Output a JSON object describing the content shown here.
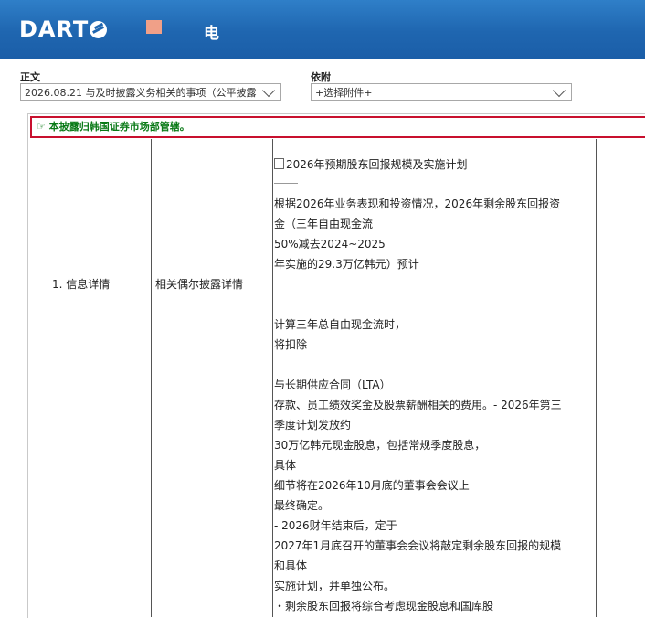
{
  "header": {
    "logo_text": "DART",
    "title": "电"
  },
  "toolbar": {
    "body_label": "正文",
    "body_select_value": "2026.08.21 与及时披露义务相关的事项（公平披露",
    "attach_label": "依附",
    "attach_select_value": "+选择附件+"
  },
  "notice": {
    "icon": "hand-pointing-icon",
    "text": "本披露归韩国证券市场部管辖。"
  },
  "table": {
    "col1": "1. 信息详情",
    "col2": "相关偶尔披露详情",
    "content_lines": [
      "2026年预期股东回报规模及实施计划",
      "根据2026年业务表现和投资情况，2026年剩余股东回报资",
      "金（三年自由现金流",
      "50%减去2024~2025",
      "年实施的29.3万亿韩元）预计",
      "计算三年总自由现金流时，",
      "将扣除",
      "与长期供应合同（LTA）",
      "存款、员工绩效奖金及股票薪酬相关的费用。- 2026年第三",
      "季度计划发放约",
      "30万亿韩元现金股息，包括常规季度股息，",
      "具体",
      "细节将在2026年10月底的董事会会议上",
      "最终确定。",
      "- 2026财年结束后，定于",
      "2027年1月底召开的董事会会议将敲定剩余股东回报的规模",
      "和具体",
      "实施计划，并单独公布。",
      "・剩余股东回报将综合考虑现金股息和国库股"
    ]
  },
  "colors": {
    "header_blue": "#1f66b0",
    "notice_border": "#c8102e",
    "notice_text": "#0a7a17"
  }
}
